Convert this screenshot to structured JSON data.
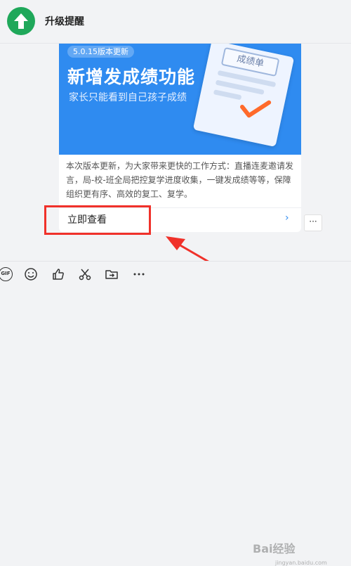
{
  "header": {
    "title": "升级提醒"
  },
  "card": {
    "version_badge": "5.0.15版本更新",
    "banner_title": "新增发成绩功能",
    "banner_subtitle": "家长只能看到自己孩子成绩",
    "paper_tag": "成绩单",
    "description": "本次版本更新，为大家带来更快的工作方式：直播连麦邀请发言，局-校-班全局把控复学进度收集，一键发成绩等等，保障组织更有序、高效的复工、复学。",
    "view_link": "立即查看",
    "chevron": "›"
  },
  "more_button": "···",
  "toolbar": {
    "gif_label": "GIF",
    "items": [
      "gif-icon",
      "emoji-icon",
      "thumbs-up-icon",
      "scissors-icon",
      "forward-icon",
      "more-icon"
    ]
  },
  "watermark": {
    "text": "Bai经验",
    "sub": "jingyan.baidu.com"
  },
  "colors": {
    "accent": "#2f8bf0",
    "brand_green": "#1fa85a",
    "highlight_red": "#f0312a"
  }
}
